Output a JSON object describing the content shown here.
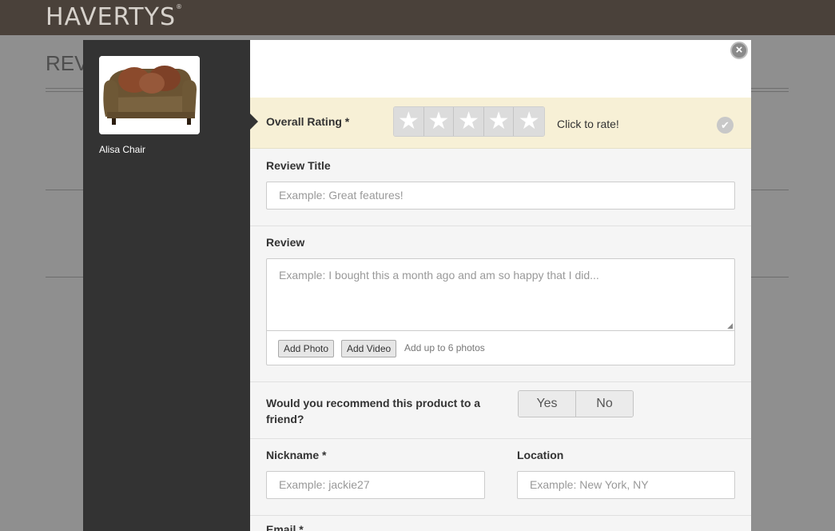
{
  "background": {
    "logo": "HAVERTYS",
    "logo_mark": "®",
    "heading_partial": "REV"
  },
  "product": {
    "name": "Alisa Chair",
    "image_icon": "armchair-image"
  },
  "close_icon": "×",
  "rating": {
    "label": "Overall Rating *",
    "stars": [
      "★",
      "★",
      "★",
      "★",
      "★"
    ],
    "hint": "Click to rate!",
    "value": 0,
    "check_icon": "✔"
  },
  "review_title": {
    "label": "Review Title",
    "placeholder": "Example: Great features!"
  },
  "review": {
    "label": "Review",
    "placeholder": "Example: I bought this a month ago and am so happy that I did...",
    "add_photo": "Add Photo",
    "add_video": "Add Video",
    "photo_hint": "Add up to 6 photos"
  },
  "recommend": {
    "question": "Would you recommend this product to a friend?",
    "yes": "Yes",
    "no": "No"
  },
  "nickname": {
    "label": "Nickname *",
    "placeholder": "Example: jackie27"
  },
  "location": {
    "label": "Location",
    "placeholder": "Example: New York, NY"
  },
  "email": {
    "label": "Email *"
  },
  "colors": {
    "sidebar": "#333333",
    "rating_bg": "#f7f0d6",
    "topbar": "#4a413a"
  }
}
